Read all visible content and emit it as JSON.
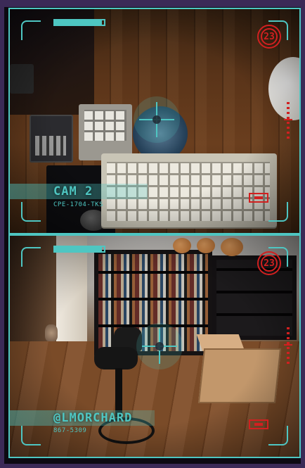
{
  "cameras": [
    {
      "title": "CAM 2",
      "subtitle": "CPE-1704-TKS",
      "badge_number": "23",
      "signal_level": 0.95
    },
    {
      "title": "@LMORCHARD",
      "subtitle": "867-5309",
      "badge_number": "23",
      "signal_level": 0.95
    }
  ],
  "icons": {
    "reticle": "crosshair-icon",
    "badge": "numbered-badge-icon",
    "record": "record-indicator-icon",
    "level": "level-meter-icon"
  },
  "colors": {
    "hud_accent": "#4ec6c2",
    "alert_red": "#d12020",
    "frame": "#3b2a57"
  }
}
